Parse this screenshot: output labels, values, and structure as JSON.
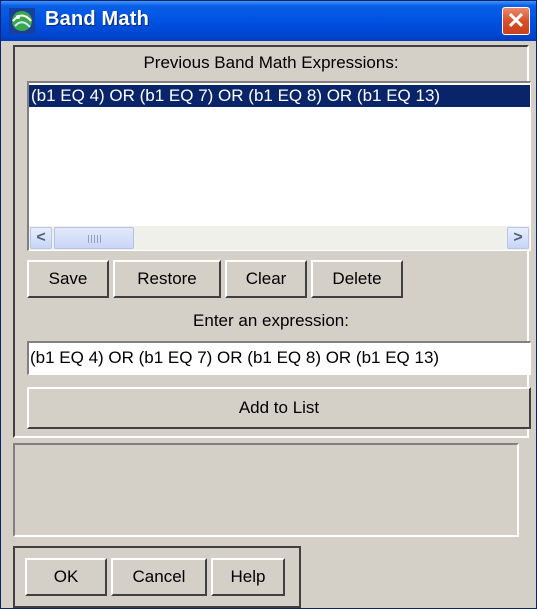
{
  "window": {
    "title": "Band Math",
    "app_icon": "envi-globe-icon",
    "close_icon": "close-icon",
    "close_glyph": "✕"
  },
  "previous": {
    "label": "Previous Band Math Expressions:",
    "items": [
      "(b1 EQ 4) OR (b1 EQ 7) OR (b1 EQ 8) OR (b1 EQ 13)"
    ],
    "scroll_left_glyph": "<",
    "scroll_right_glyph": ">"
  },
  "buttons": {
    "save": "Save",
    "restore": "Restore",
    "clear": "Clear",
    "delete": "Delete"
  },
  "expression": {
    "label": "Enter an expression:",
    "value": "(b1 EQ 4) OR (b1 EQ 7) OR (b1 EQ 8) OR (b1 EQ 13)",
    "add_button": "Add to List"
  },
  "footer": {
    "ok": "OK",
    "cancel": "Cancel",
    "help": "Help"
  },
  "colors": {
    "titlebar": "#0054e3",
    "selection": "#0a246a",
    "dialog_face": "#d4d0c8"
  }
}
